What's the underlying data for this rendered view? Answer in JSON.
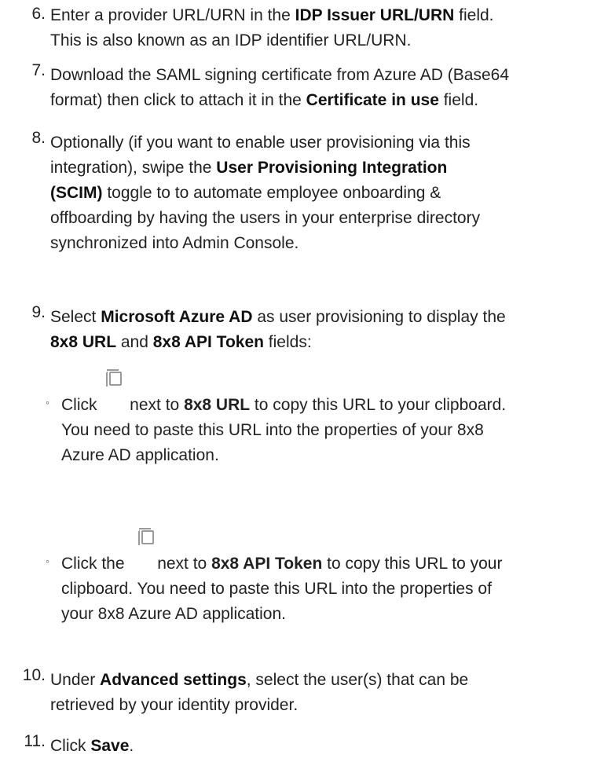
{
  "steps": [
    {
      "num": "6.",
      "lines": [
        [
          "Enter a provider URL/URN in the ",
          {
            "b": "IDP Issuer URL/URN"
          },
          " field."
        ],
        [
          "This is also known as an IDP identifier URL/URN."
        ]
      ]
    },
    {
      "num": "7.",
      "lines": [
        [
          "Download the SAML signing certificate from Azure AD (Base64"
        ],
        [
          "format) then click to attach it in the ",
          {
            "b": "Certificate in use"
          },
          " field."
        ]
      ]
    },
    {
      "num": "8.",
      "lines": [
        [
          "Optionally (if you want to enable user provisioning via this"
        ],
        [
          "integration), swipe the ",
          {
            "b": "User Provisioning Integration"
          }
        ],
        [
          {
            "b": "(SCIM)"
          },
          " toggle to to automate employee onboarding &"
        ],
        [
          "offboarding by having the users in your enterprise directory"
        ],
        [
          "synchronized into Admin Console."
        ]
      ]
    },
    {
      "num": "9.",
      "lines": [
        [
          "Select ",
          {
            "b": "Microsoft Azure AD"
          },
          " as user provisioning to display the"
        ],
        [
          {
            "b": "8x8 URL"
          },
          " and ",
          {
            "b": "8x8 API Token"
          },
          " fields:"
        ]
      ]
    },
    {
      "num": "10.",
      "lines": [
        [
          "Under ",
          {
            "b": "Advanced settings"
          },
          ", select the user(s) that can be"
        ],
        [
          "retrieved by your identity provider."
        ]
      ]
    },
    {
      "num": "11.",
      "lines": [
        [
          "Click ",
          {
            "b": "Save"
          },
          "."
        ]
      ]
    }
  ],
  "bullets": [
    {
      "marker": "◦",
      "icon": "copy-icon",
      "lines": [
        [
          "Click ",
          {
            "icon": true
          },
          " next to ",
          {
            "b": "8x8 URL"
          },
          " to copy this URL to your clipboard."
        ],
        [
          "You need to paste this URL into the properties of your 8x8"
        ],
        [
          "Azure AD application."
        ]
      ]
    },
    {
      "marker": "◦",
      "icon": "copy-icon",
      "lines": [
        [
          "Click the ",
          {
            "icon": true
          },
          " next to ",
          {
            "b": "8x8 API Token"
          },
          " to copy this URL to your"
        ],
        [
          "clipboard. You need to paste this URL into the properties of"
        ],
        [
          "your 8x8 Azure AD application."
        ]
      ]
    }
  ],
  "colors": {
    "text": "#222222",
    "icon": "#9a9a9a"
  }
}
